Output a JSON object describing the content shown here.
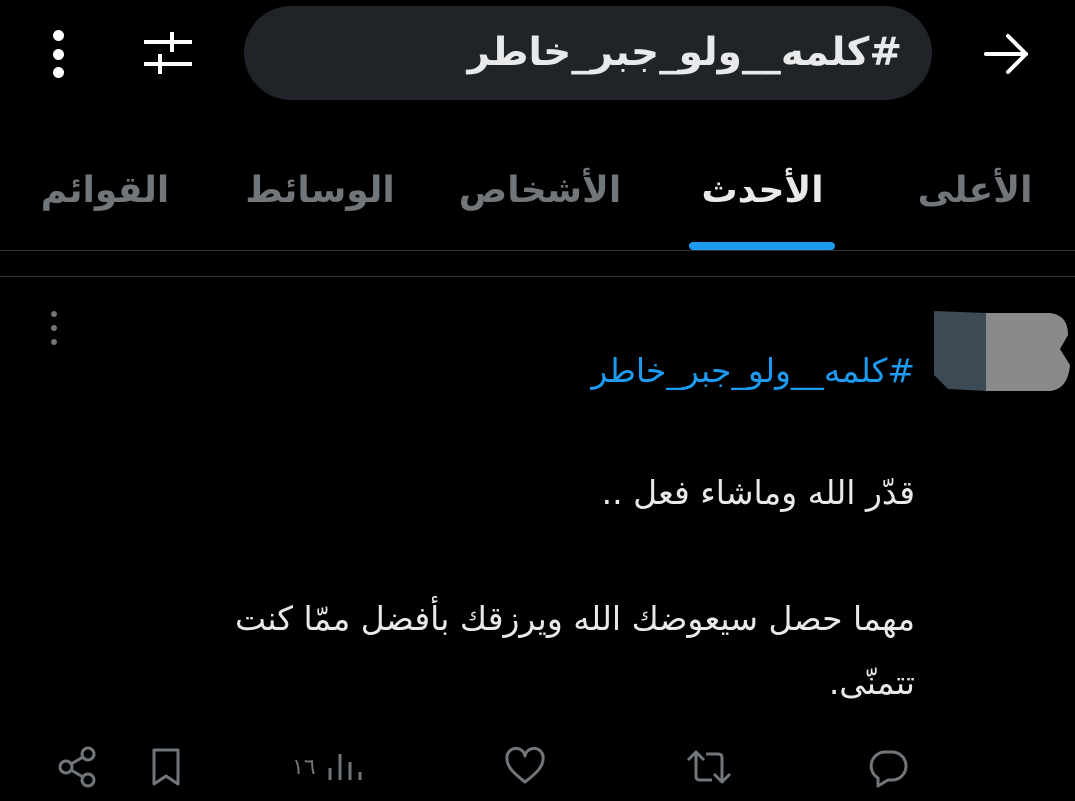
{
  "search": {
    "query": "#كلمه__ولو_جبر_خاطر"
  },
  "tabs": [
    {
      "label": "الأعلى"
    },
    {
      "label": "الأحدث"
    },
    {
      "label": "الأشخاص"
    },
    {
      "label": "الوسائط"
    },
    {
      "label": "القوائم"
    }
  ],
  "active_tab": "الأحدث",
  "tweet": {
    "hashtag": "#كلمه__ولو_جبر_خاطر",
    "lines": [
      "قدّر الله وماشاء فعل ..",
      "مهما حصل سيعوضك الله ويرزقك بأفضل ممّا كنت",
      "تتمنّى."
    ],
    "views": "١٦"
  },
  "icons": {
    "menu": "vertical-dots-icon",
    "filter": "sliders-icon",
    "back": "arrow-right-icon",
    "more": "more-dots-icon",
    "reply": "reply-icon",
    "retweet": "retweet-icon",
    "like": "heart-icon",
    "views": "analytics-icon",
    "bookmark": "bookmark-icon",
    "share": "share-icon"
  },
  "colors": {
    "accent": "#1d9bf0",
    "background": "#000000",
    "search_bg": "#202327",
    "muted": "#71767b"
  }
}
